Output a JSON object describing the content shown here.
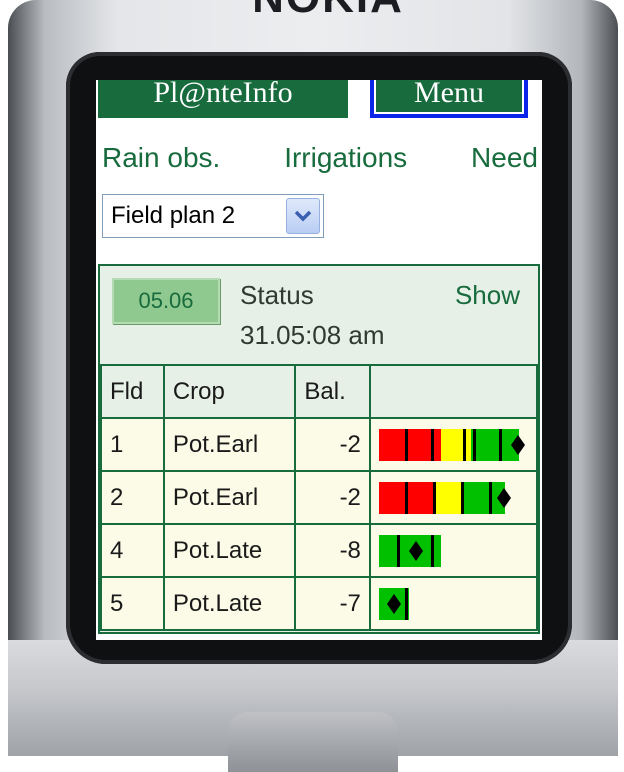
{
  "phone": {
    "brand": "NOKIA"
  },
  "header": {
    "logo": "Pl@nteInfo",
    "menu_label": "Menu"
  },
  "nav": {
    "links": [
      "Rain obs.",
      "Irrigations",
      "Need"
    ]
  },
  "field_select": {
    "value": "Field plan 2"
  },
  "status": {
    "date_button": "05.06",
    "label": "Status",
    "timestamp": "31.05:08 am",
    "show_label": "Show"
  },
  "table": {
    "headers": [
      "Fld",
      "Crop",
      "Bal.",
      ""
    ],
    "rows": [
      {
        "fld": "1",
        "crop": "Pot.Earl",
        "bal": "-2",
        "bar": {
          "segments": [
            {
              "c": "#ff0000",
              "w": 62
            },
            {
              "c": "#ffff00",
              "w": 30
            },
            {
              "c": "#00c000",
              "w": 48
            }
          ],
          "ticks": [
            26,
            52,
            84,
            94,
            120
          ],
          "diamond": 132
        }
      },
      {
        "fld": "2",
        "crop": "Pot.Earl",
        "bal": "-2",
        "bar": {
          "segments": [
            {
              "c": "#ff0000",
              "w": 54
            },
            {
              "c": "#ffff00",
              "w": 28
            },
            {
              "c": "#00c000",
              "w": 44
            }
          ],
          "ticks": [
            26,
            54,
            82,
            110
          ],
          "diamond": 118
        }
      },
      {
        "fld": "4",
        "crop": "Pot.Late",
        "bal": "-8",
        "bar": {
          "segments": [
            {
              "c": "#00c000",
              "w": 62
            }
          ],
          "ticks": [
            18,
            52
          ],
          "diamond": 30
        }
      },
      {
        "fld": "5",
        "crop": "Pot.Late",
        "bal": "-7",
        "bar": {
          "segments": [
            {
              "c": "#00c000",
              "w": 30
            }
          ],
          "ticks": [
            26
          ],
          "diamond": 8
        }
      }
    ]
  },
  "colors": {
    "brand_green": "#176b3d",
    "menu_border": "#0a25e8",
    "panel_bg": "#e6f0e6",
    "cell_bg": "#fbfbe8"
  },
  "icons": {
    "select_arrow": "chevron-down-icon",
    "marker": "diamond-marker-icon"
  }
}
